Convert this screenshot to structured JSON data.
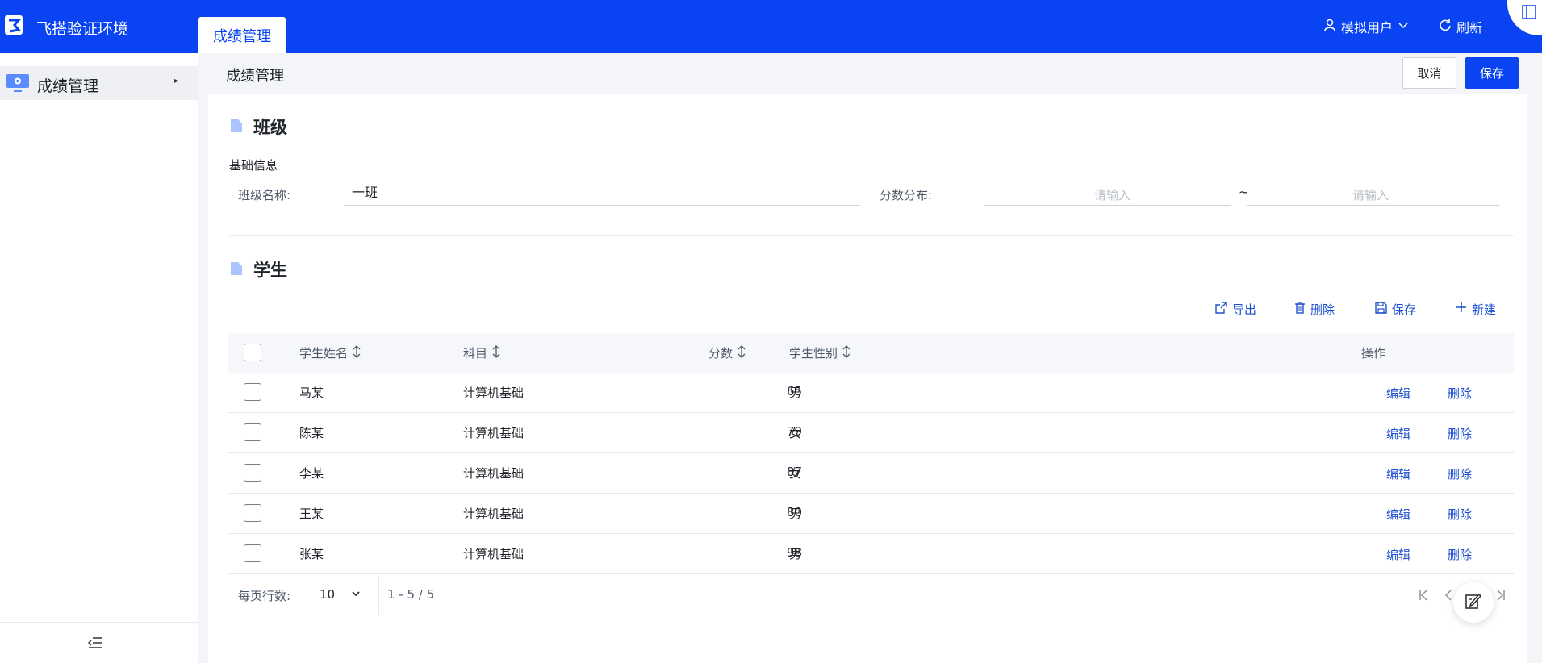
{
  "topbar": {
    "app_title": "飞搭验证环境",
    "active_tab": "成绩管理",
    "user_label": "模拟用户",
    "refresh_label": "刷新"
  },
  "sidebar": {
    "items": [
      {
        "label": "成绩管理"
      }
    ]
  },
  "page": {
    "title": "成绩管理",
    "cancel_label": "取消",
    "save_label": "保存"
  },
  "class_section": {
    "title": "班级",
    "subtitle": "基础信息",
    "class_name_label": "班级名称:",
    "class_name_value": "一班",
    "score_range_label": "分数分布:",
    "range_min_placeholder": "请输入",
    "range_separator": "~",
    "range_max_placeholder": "请输入"
  },
  "student_section": {
    "title": "学生",
    "toolbar": {
      "export": "导出",
      "delete": "删除",
      "save": "保存",
      "new": "新建"
    },
    "columns": {
      "name": "学生姓名",
      "subject": "科目",
      "score": "分数",
      "gender": "学生性别",
      "actions": "操作"
    },
    "rows": [
      {
        "name": "马某",
        "subject": "计算机基础",
        "score": "65",
        "gender": "男",
        "edit": "编辑",
        "delete": "删除"
      },
      {
        "name": "陈某",
        "subject": "计算机基础",
        "score": "79",
        "gender": "女",
        "edit": "编辑",
        "delete": "删除"
      },
      {
        "name": "李某",
        "subject": "计算机基础",
        "score": "87",
        "gender": "女",
        "edit": "编辑",
        "delete": "删除"
      },
      {
        "name": "王某",
        "subject": "计算机基础",
        "score": "80",
        "gender": "男",
        "edit": "编辑",
        "delete": "删除"
      },
      {
        "name": "张某",
        "subject": "计算机基础",
        "score": "98",
        "gender": "男",
        "edit": "编辑",
        "delete": "删除"
      }
    ],
    "pagination": {
      "rows_per_page_label": "每页行数:",
      "rows_per_page_value": "10",
      "range_text": "1 - 5 / 5"
    }
  },
  "colors": {
    "brand": "#0a44f2",
    "link": "#1e4fd0"
  }
}
